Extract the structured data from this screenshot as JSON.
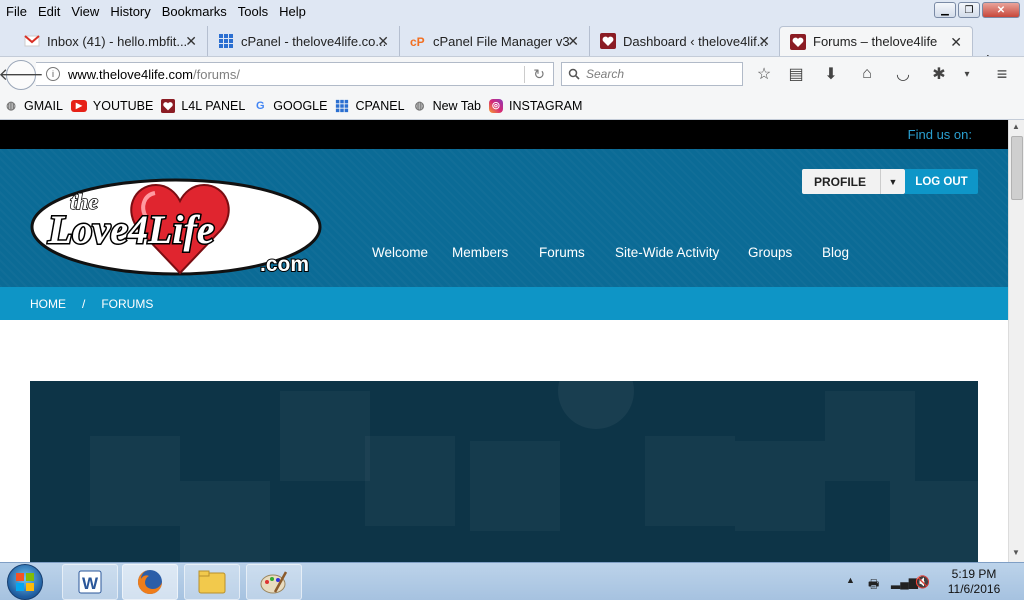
{
  "menubar": {
    "items": [
      "File",
      "Edit",
      "View",
      "History",
      "Bookmarks",
      "Tools",
      "Help"
    ]
  },
  "tabs": [
    {
      "title": "Inbox (41) - hello.mbfit...",
      "icon": "gmail-icon"
    },
    {
      "title": "cPanel - thelove4life.co...",
      "icon": "grid-icon"
    },
    {
      "title": "cPanel File Manager v3",
      "icon": "cpanel-icon"
    },
    {
      "title": "Dashboard ‹ thelove4lif...",
      "icon": "love4life-favicon"
    },
    {
      "title": "Forums – thelove4life",
      "icon": "love4life-favicon",
      "active": true
    }
  ],
  "navbar": {
    "url_domain": "www.thelove4life.com",
    "url_path": "/forums/",
    "search_placeholder": "Search"
  },
  "bookmarks": [
    {
      "label": "GMAIL",
      "icon": "globe-icon"
    },
    {
      "label": "YOUTUBE",
      "icon": "youtube-icon"
    },
    {
      "label": "L4L PANEL",
      "icon": "love4life-favicon"
    },
    {
      "label": "GOOGLE",
      "icon": "google-icon"
    },
    {
      "label": "CPANEL",
      "icon": "grid-icon"
    },
    {
      "label": "New Tab",
      "icon": "globe-icon"
    },
    {
      "label": "INSTAGRAM",
      "icon": "instagram-icon"
    }
  ],
  "site": {
    "find_us": "Find us on:",
    "logo": {
      "line1": "the",
      "line2": "Love4Life",
      "line3": ".com"
    },
    "nav": [
      "Welcome",
      "Members",
      "Forums",
      "Site-Wide Activity",
      "Groups",
      "Blog"
    ],
    "profile_label": "PROFILE",
    "logout_label": "LOG OUT",
    "breadcrumb": [
      "HOME",
      "FORUMS"
    ],
    "breadcrumb_sep": "/"
  },
  "colors": {
    "header_blue": "#0b6b96",
    "breadcrumb_blue": "#0e95c6",
    "logout_blue": "#0e96c8",
    "banner_dark": "#0d3447",
    "find_us": "#2a9fd0"
  },
  "taskbar": {
    "apps": [
      "word-icon",
      "firefox-icon",
      "explorer-icon",
      "paint-icon"
    ],
    "time": "5:19 PM",
    "date": "11/6/2016"
  }
}
